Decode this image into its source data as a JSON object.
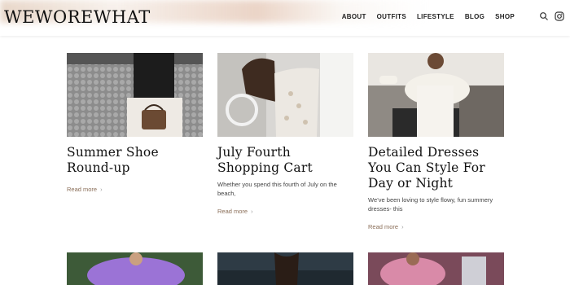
{
  "brand": {
    "logo": "WEWOREWHAT"
  },
  "nav": {
    "items": [
      "ABOUT",
      "OUTFITS",
      "LIFESTYLE",
      "BLOG",
      "SHOP"
    ]
  },
  "icons": {
    "search": "search-icon",
    "instagram": "instagram-icon"
  },
  "posts": [
    {
      "title": "Summer Shoe Round-up",
      "excerpt": "",
      "read_more": "Read more"
    },
    {
      "title": "July Fourth Shopping Cart",
      "excerpt": "Whether you spend this fourth of July on the beach,",
      "read_more": "Read more"
    },
    {
      "title": "Detailed Dresses You Can Style For Day or Night",
      "excerpt": "We’ve been loving to style flowy, fun summery dresses- this",
      "read_more": "Read more"
    }
  ]
}
